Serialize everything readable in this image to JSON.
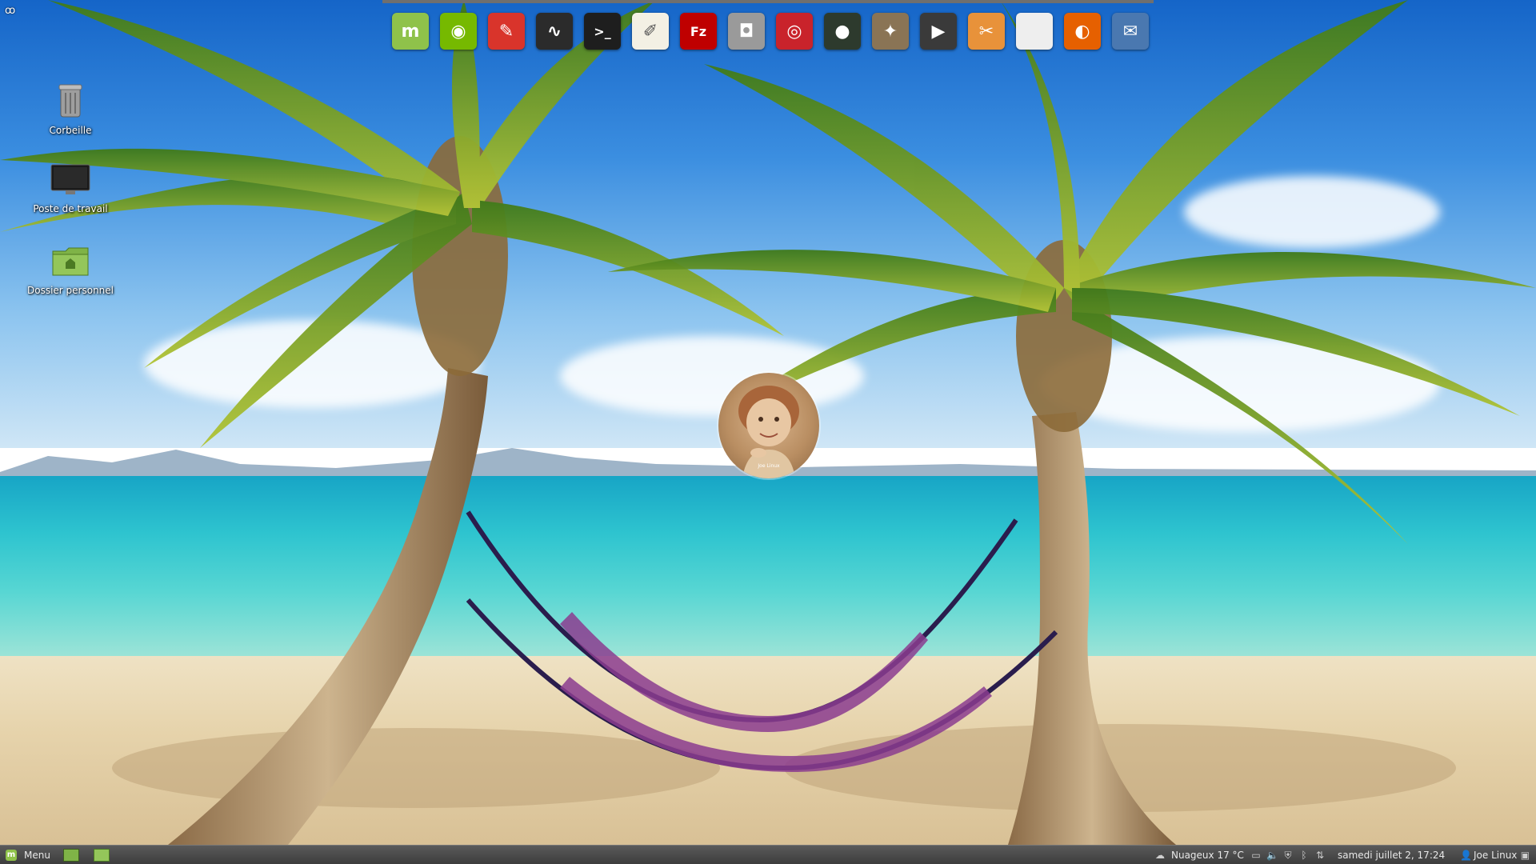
{
  "desktop": {
    "corner_glyph": "ꝏ",
    "icons": [
      {
        "label": "Corbeille",
        "icon": "trash-icon"
      },
      {
        "label": "Poste de travail",
        "icon": "computer-icon"
      },
      {
        "label": "Dossier personnel",
        "icon": "home-folder-icon"
      }
    ],
    "avatar_caption": "Joe Linux"
  },
  "dock": {
    "items": [
      {
        "name": "linux-mint-icon",
        "glyph": "m",
        "color": "#8fc24a"
      },
      {
        "name": "nvidia-icon",
        "glyph": "◉",
        "color": "#76b900"
      },
      {
        "name": "system-cleaner-icon",
        "glyph": "✎",
        "color": "#d9342b"
      },
      {
        "name": "system-monitor-icon",
        "glyph": "∿",
        "color": "#2b2b2b"
      },
      {
        "name": "terminal-icon",
        "glyph": ">_",
        "color": "#1e1e1e"
      },
      {
        "name": "text-editor-icon",
        "glyph": "✐",
        "color": "#f3f0e4"
      },
      {
        "name": "filezilla-icon",
        "glyph": "Fz",
        "color": "#bf0000"
      },
      {
        "name": "camera-icon",
        "glyph": "◘",
        "color": "#9a9a9a"
      },
      {
        "name": "disc-burner-icon",
        "glyph": "◎",
        "color": "#c9232b"
      },
      {
        "name": "webcam-icon",
        "glyph": "●",
        "color": "#2d3a2d"
      },
      {
        "name": "gimp-icon",
        "glyph": "✦",
        "color": "#8a7455"
      },
      {
        "name": "video-player-icon",
        "glyph": "▶",
        "color": "#3a3a3a"
      },
      {
        "name": "video-editor-icon",
        "glyph": "✂",
        "color": "#e8923a"
      },
      {
        "name": "blank-document-icon",
        "glyph": "",
        "color": "#eeeeee"
      },
      {
        "name": "firefox-icon",
        "glyph": "◐",
        "color": "#e66000"
      },
      {
        "name": "thunderbird-icon",
        "glyph": "✉",
        "color": "#4a78b0"
      }
    ]
  },
  "panel": {
    "menu_label": "Menu",
    "weather": "Nuageux 17 °C",
    "clock": "samedi juillet  2, 17:24",
    "user": "Joe Linux"
  }
}
